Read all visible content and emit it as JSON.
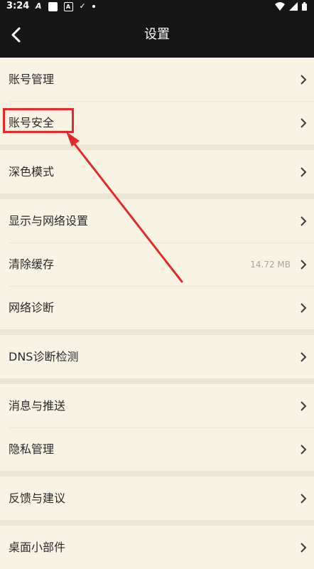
{
  "status_bar": {
    "time": "3:24",
    "left_icons": [
      "navigation-a-icon",
      "notification-square-icon",
      "notification-a-box-icon",
      "check-icon",
      "dot-icon"
    ],
    "right_icons": [
      "wifi-icon",
      "cell-signal-icon",
      "battery-icon"
    ]
  },
  "header": {
    "title": "设置",
    "back_icon": "chevron-left-icon"
  },
  "groups": [
    {
      "items": [
        {
          "label": "账号管理"
        },
        {
          "label": "账号安全"
        }
      ]
    },
    {
      "items": [
        {
          "label": "深色模式"
        }
      ]
    },
    {
      "items": [
        {
          "label": "显示与网络设置"
        },
        {
          "label": "清除缓存",
          "value": "14.72 MB"
        },
        {
          "label": "网络诊断"
        }
      ]
    },
    {
      "items": [
        {
          "label": "DNS诊断检测"
        }
      ]
    },
    {
      "items": [
        {
          "label": "消息与推送"
        },
        {
          "label": "隐私管理"
        }
      ]
    },
    {
      "items": [
        {
          "label": "反馈与建议"
        }
      ]
    },
    {
      "items": [
        {
          "label": "桌面小部件"
        }
      ]
    }
  ],
  "annotation": {
    "highlight_color": "#e02b2b",
    "highlighted_item": "账号安全"
  },
  "colors": {
    "background": "#f8f3e3",
    "separator_band": "#ebe5d3",
    "header": "#161616"
  }
}
